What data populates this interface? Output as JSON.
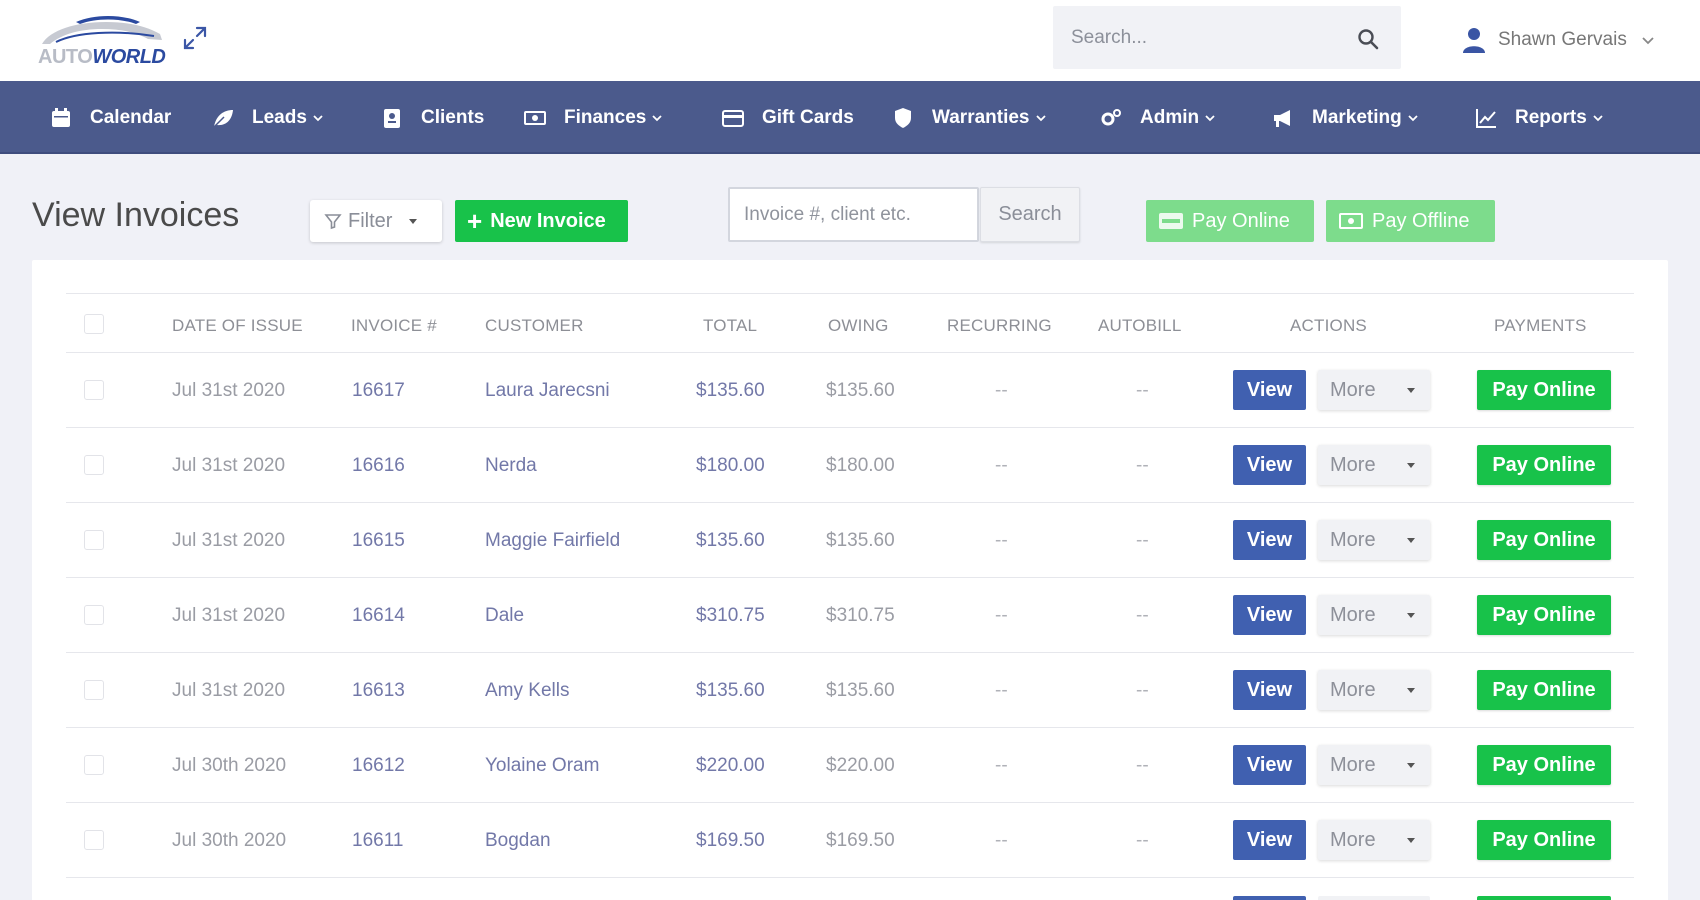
{
  "header": {
    "logo": {
      "line1": "AUTO",
      "line2": "WORLD"
    },
    "search_placeholder": "Search...",
    "user_name": "Shawn Gervais"
  },
  "nav": {
    "items": [
      {
        "label": "Calendar",
        "icon": "calendar-icon",
        "dropdown": false
      },
      {
        "label": "Leads",
        "icon": "leaf-icon",
        "dropdown": true
      },
      {
        "label": "Clients",
        "icon": "client-card-icon",
        "dropdown": false
      },
      {
        "label": "Finances",
        "icon": "money-icon",
        "dropdown": true
      },
      {
        "label": "Gift Cards",
        "icon": "credit-card-icon",
        "dropdown": false
      },
      {
        "label": "Warranties",
        "icon": "shield-icon",
        "dropdown": true
      },
      {
        "label": "Admin",
        "icon": "gears-icon",
        "dropdown": true
      },
      {
        "label": "Marketing",
        "icon": "bullhorn-icon",
        "dropdown": true
      },
      {
        "label": "Reports",
        "icon": "line-chart-icon",
        "dropdown": true
      }
    ]
  },
  "toolbar": {
    "title": "View Invoices",
    "filter_label": "Filter",
    "new_invoice_label": "New Invoice",
    "invoice_search_placeholder": "Invoice #, client etc.",
    "search_button": "Search",
    "pay_online_label": "Pay Online",
    "pay_offline_label": "Pay Offline"
  },
  "table": {
    "columns": [
      "DATE OF ISSUE",
      "INVOICE #",
      "CUSTOMER",
      "TOTAL",
      "OWING",
      "RECURRING",
      "AUTOBILL",
      "ACTIONS",
      "PAYMENTS"
    ],
    "view_label": "View",
    "more_label": "More",
    "pay_label": "Pay Online",
    "rows": [
      {
        "date": "Jul 31st 2020",
        "invoice": "16617",
        "customer": "Laura Jarecsni",
        "total": "$135.60",
        "owing": "$135.60",
        "recurring": "--",
        "autobill": "--"
      },
      {
        "date": "Jul 31st 2020",
        "invoice": "16616",
        "customer": "Nerda",
        "total": "$180.00",
        "owing": "$180.00",
        "recurring": "--",
        "autobill": "--"
      },
      {
        "date": "Jul 31st 2020",
        "invoice": "16615",
        "customer": "Maggie Fairfield",
        "total": "$135.60",
        "owing": "$135.60",
        "recurring": "--",
        "autobill": "--"
      },
      {
        "date": "Jul 31st 2020",
        "invoice": "16614",
        "customer": "Dale",
        "total": "$310.75",
        "owing": "$310.75",
        "recurring": "--",
        "autobill": "--"
      },
      {
        "date": "Jul 31st 2020",
        "invoice": "16613",
        "customer": "Amy Kells",
        "total": "$135.60",
        "owing": "$135.60",
        "recurring": "--",
        "autobill": "--"
      },
      {
        "date": "Jul 30th 2020",
        "invoice": "16612",
        "customer": "Yolaine Oram",
        "total": "$220.00",
        "owing": "$220.00",
        "recurring": "--",
        "autobill": "--"
      },
      {
        "date": "Jul 30th 2020",
        "invoice": "16611",
        "customer": "Bogdan",
        "total": "$169.50",
        "owing": "$169.50",
        "recurring": "--",
        "autobill": "--"
      }
    ]
  },
  "colors": {
    "nav_bg": "#4b5a8c",
    "green": "#18c24a",
    "light_green": "#7ddc8c",
    "view_blue": "#4060b0",
    "page_bg": "#f0f1f7"
  }
}
